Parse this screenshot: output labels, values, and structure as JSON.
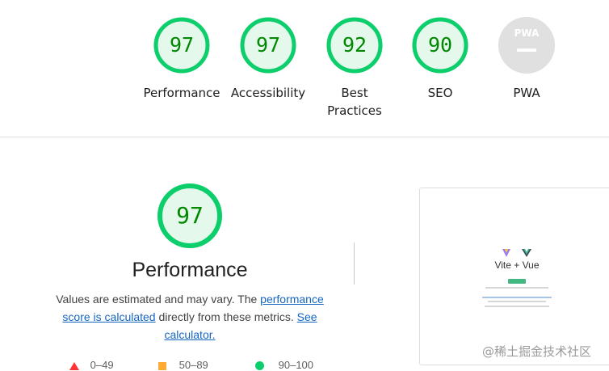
{
  "categories": [
    {
      "score": "97",
      "label": "Performance"
    },
    {
      "score": "97",
      "label": "Accessibility"
    },
    {
      "score": "92",
      "label_line1": "Best",
      "label_line2": "Practices"
    },
    {
      "score": "90",
      "label": "SEO"
    },
    {
      "badge": "PWA",
      "label": "PWA"
    }
  ],
  "main": {
    "score": "97",
    "title": "Performance",
    "desc_prefix": "Values are estimated and may vary. The ",
    "desc_link1": "performance score is calculated",
    "desc_middle": " directly from these metrics. ",
    "desc_link2": "See calculator."
  },
  "legend": [
    {
      "range": "0–49",
      "color": "#ff3333",
      "icon": "triangle-icon"
    },
    {
      "range": "50–89",
      "color": "#ffaa33",
      "icon": "square-icon"
    },
    {
      "range": "90–100",
      "color": "#0cce6b",
      "icon": "circle-icon"
    }
  ],
  "screenshot": {
    "title": "Vite + Vue"
  },
  "watermark": "@稀土掘金技术社区",
  "colors": {
    "pass": "#0cce6b",
    "pass_fill": "#e5f8ec",
    "pass_text": "#008800",
    "na": "#e0e0e0"
  }
}
